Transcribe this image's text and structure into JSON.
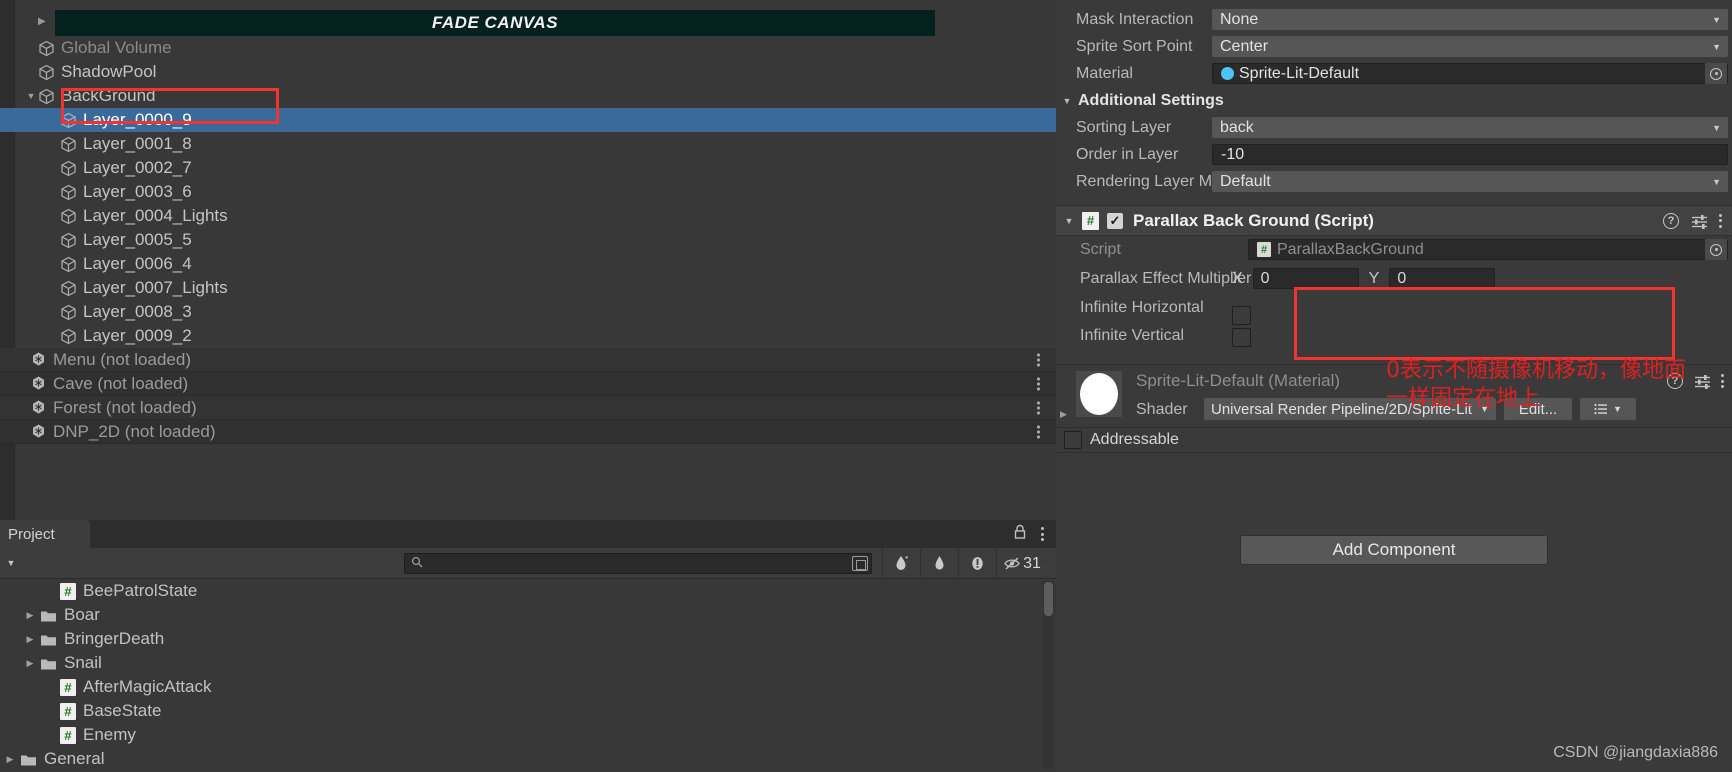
{
  "hierarchy": {
    "banner": {
      "label": "FADE CANVAS"
    },
    "items": [
      {
        "label": "Global Volume",
        "indent": 1,
        "fold": "none",
        "icon": "cube-icon",
        "state": "dim"
      },
      {
        "label": "ShadowPool",
        "indent": 1,
        "fold": "none",
        "icon": "cube-icon",
        "state": "normal"
      },
      {
        "label": "BackGround",
        "indent": 1,
        "fold": "open",
        "icon": "cube-icon",
        "state": "normal"
      },
      {
        "label": "Layer_0000_9",
        "indent": 2,
        "fold": "none",
        "icon": "cube-icon",
        "state": "selected"
      },
      {
        "label": "Layer_0001_8",
        "indent": 2,
        "fold": "none",
        "icon": "cube-icon",
        "state": "normal"
      },
      {
        "label": "Layer_0002_7",
        "indent": 2,
        "fold": "none",
        "icon": "cube-icon",
        "state": "normal"
      },
      {
        "label": "Layer_0003_6",
        "indent": 2,
        "fold": "none",
        "icon": "cube-icon",
        "state": "normal"
      },
      {
        "label": "Layer_0004_Lights",
        "indent": 2,
        "fold": "none",
        "icon": "cube-icon",
        "state": "normal"
      },
      {
        "label": "Layer_0005_5",
        "indent": 2,
        "fold": "none",
        "icon": "cube-icon",
        "state": "normal"
      },
      {
        "label": "Layer_0006_4",
        "indent": 2,
        "fold": "none",
        "icon": "cube-icon",
        "state": "normal"
      },
      {
        "label": "Layer_0007_Lights",
        "indent": 2,
        "fold": "none",
        "icon": "cube-icon",
        "state": "normal"
      },
      {
        "label": "Layer_0008_3",
        "indent": 2,
        "fold": "none",
        "icon": "cube-icon",
        "state": "normal"
      },
      {
        "label": "Layer_0009_2",
        "indent": 2,
        "fold": "none",
        "icon": "cube-icon",
        "state": "normal"
      }
    ],
    "scenes": [
      {
        "label": "Menu (not loaded)"
      },
      {
        "label": "Cave (not loaded)"
      },
      {
        "label": "Forest (not loaded)"
      },
      {
        "label": "DNP_2D (not loaded)"
      }
    ]
  },
  "project": {
    "tab_label": "Project",
    "search_placeholder": "",
    "hidden_count": "31",
    "items": [
      {
        "label": "BeePatrolState",
        "icon": "cs-script-icon",
        "indent": 2,
        "fold": "none"
      },
      {
        "label": "Boar",
        "icon": "folder-icon",
        "indent": 1,
        "fold": "closed"
      },
      {
        "label": "BringerDeath",
        "icon": "folder-icon",
        "indent": 1,
        "fold": "closed"
      },
      {
        "label": "Snail",
        "icon": "folder-icon",
        "indent": 1,
        "fold": "closed"
      },
      {
        "label": "AfterMagicAttack",
        "icon": "cs-script-icon",
        "indent": 2,
        "fold": "none"
      },
      {
        "label": "BaseState",
        "icon": "cs-script-icon",
        "indent": 2,
        "fold": "none"
      },
      {
        "label": "Enemy",
        "icon": "cs-script-icon",
        "indent": 2,
        "fold": "none"
      },
      {
        "label": "General",
        "icon": "folder-icon",
        "indent": 0,
        "fold": "closed"
      }
    ]
  },
  "inspector": {
    "sprite_renderer": {
      "rows": [
        {
          "label": "Mask Interaction",
          "value": "None",
          "type": "dropdown"
        },
        {
          "label": "Sprite Sort Point",
          "value": "Center",
          "type": "dropdown"
        },
        {
          "label": "Material",
          "value": "Sprite-Lit-Default",
          "type": "object"
        }
      ]
    },
    "additional_settings": {
      "title": "Additional Settings",
      "rows": [
        {
          "label": "Sorting Layer",
          "value": "back",
          "type": "dropdown"
        },
        {
          "label": "Order in Layer",
          "value": "-10",
          "type": "number"
        },
        {
          "label": "Rendering Layer Mask",
          "value": "Default",
          "type": "dropdown"
        }
      ]
    },
    "parallax_component": {
      "title": "Parallax Back Ground (Script)",
      "enabled": true,
      "script_label": "Script",
      "script_value": "ParallaxBackGround",
      "multiplier_label": "Parallax Effect Multiplier",
      "x_axis": "X",
      "x_value": "0",
      "y_axis": "Y",
      "y_value": "0",
      "infinite_horizontal_label": "Infinite Horizontal",
      "infinite_horizontal_checked": false,
      "infinite_vertical_label": "Infinite Vertical",
      "infinite_vertical_checked": false
    },
    "material_block": {
      "title": "Sprite-Lit-Default (Material)",
      "shader_label": "Shader",
      "shader_value": "Universal Render Pipeline/2D/Sprite-Lit",
      "edit_label": "Edit...",
      "addressable_label": "Addressable",
      "addressable_checked": false
    },
    "add_component_label": "Add Component"
  },
  "annotations": {
    "note": "0表示不随摄像机移动，像地面\n一样固定在地上",
    "color": "#e02020"
  },
  "watermark": "CSDN @jiangdaxia886"
}
